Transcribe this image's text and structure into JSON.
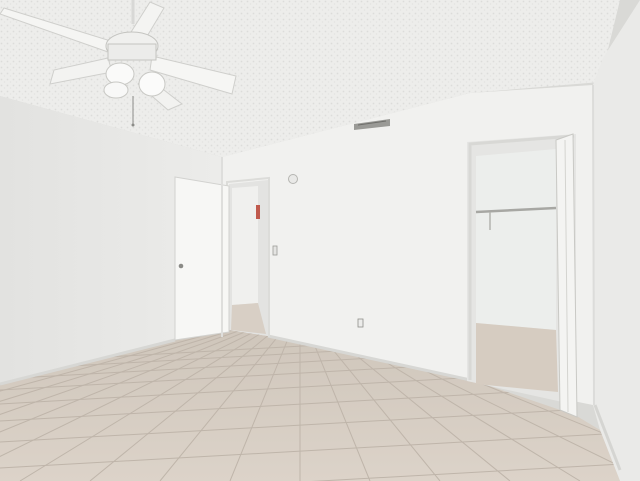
{
  "scene": {
    "description_free": true,
    "watermark_text": "",
    "colors": {
      "ceiling": "#eeeeec",
      "wall_left": "#e6e6e4",
      "wall_back": "#f2f2f0",
      "wall_right": "#ebebea",
      "floor_tile": "#d9cfc4",
      "grout": "#c6bcb1",
      "door": "#f6f6f4",
      "closet_interior": "#ecedec",
      "hallway": "#e4e4e2"
    },
    "icons": [
      "ceiling-fan-icon",
      "air-vent-icon",
      "thermostat-icon",
      "light-switch-icon",
      "power-outlet-icon",
      "closet-rod-icon"
    ]
  }
}
